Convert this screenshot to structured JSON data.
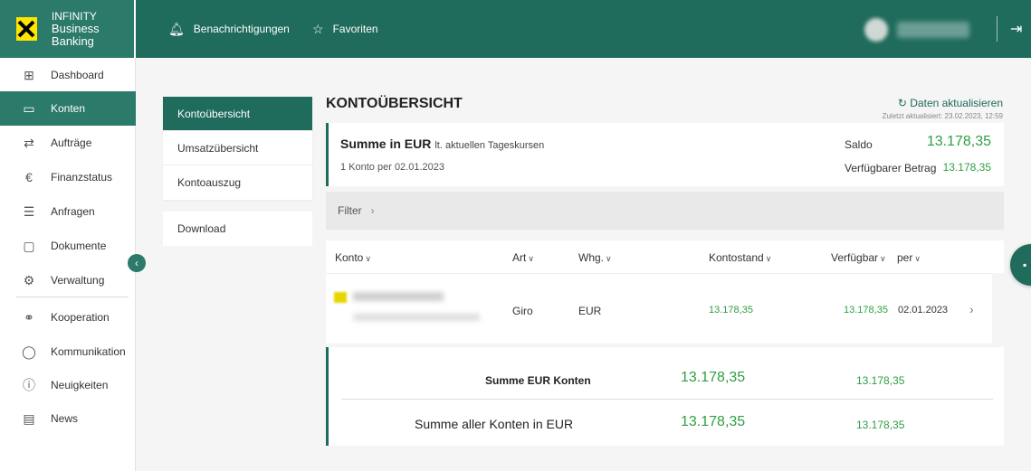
{
  "brand": {
    "line1": "INFINITY",
    "line2": "Business Banking"
  },
  "header": {
    "notifications_label": "Benachrichtigungen",
    "favorites_label": "Favoriten"
  },
  "sidebar": {
    "items": [
      {
        "label": "Dashboard",
        "icon": "grid-icon"
      },
      {
        "label": "Konten",
        "icon": "cards-icon"
      },
      {
        "label": "Aufträge",
        "icon": "orders-icon"
      },
      {
        "label": "Finanzstatus",
        "icon": "euro-status-icon"
      },
      {
        "label": "Anfragen",
        "icon": "requests-icon"
      },
      {
        "label": "Dokumente",
        "icon": "documents-icon"
      },
      {
        "label": "Verwaltung",
        "icon": "gear-icon"
      },
      {
        "label": "Kooperation",
        "icon": "handshake-icon"
      },
      {
        "label": "Kommunikation",
        "icon": "chat-icon"
      },
      {
        "label": "Neuigkeiten",
        "icon": "info-icon"
      },
      {
        "label": "News",
        "icon": "news-icon"
      }
    ]
  },
  "subnav": {
    "items": [
      "Kontoübersicht",
      "Umsatzübersicht",
      "Kontoauszug"
    ],
    "download": "Download"
  },
  "main": {
    "title": "KONTOÜBERSICHT",
    "refresh_label": "Daten aktualisieren",
    "last_updated": "Zuletzt aktualisiert: 23.02.2023, 12:59",
    "summary": {
      "title": "Summe in EUR",
      "title_sub": "lt. aktuellen Tageskursen",
      "count": "1 Konto",
      "per_date": "per 02.01.2023",
      "saldo_label": "Saldo",
      "saldo_value": "13.178,35",
      "available_label": "Verfügbarer Betrag",
      "available_value": "13.178,35"
    },
    "filter_label": "Filter",
    "table": {
      "headers": {
        "konto": "Konto",
        "art": "Art",
        "whg": "Whg.",
        "kontostand": "Kontostand",
        "verfuegbar": "Verfügbar",
        "per": "per"
      },
      "rows": [
        {
          "art": "Giro",
          "whg": "EUR",
          "kontostand": "13.178,35",
          "verfuegbar": "13.178,35",
          "per": "02.01.2023"
        }
      ]
    },
    "totals": {
      "eur_label": "Summe EUR Konten",
      "eur_kontostand": "13.178,35",
      "eur_verfuegbar": "13.178,35",
      "all_label": "Summe aller Konten in EUR",
      "all_kontostand": "13.178,35",
      "all_verfuegbar": "13.178,35"
    }
  },
  "colors": {
    "primary": "#1f6b5c",
    "accent_green": "#2ea043",
    "logo_yellow": "#ffe500"
  }
}
